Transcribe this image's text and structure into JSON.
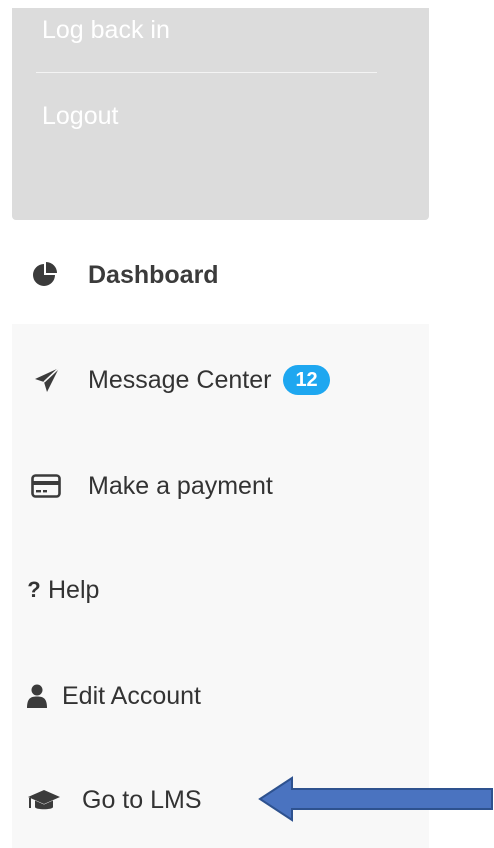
{
  "account_menu": {
    "login_label": "Log back in",
    "logout_label": "Logout"
  },
  "dashboard": {
    "label": "Dashboard",
    "icon": "pie-chart-icon"
  },
  "nav": {
    "items": [
      {
        "label": "Message Center",
        "icon": "paper-plane-icon",
        "badge": "12"
      },
      {
        "label": "Make a payment",
        "icon": "credit-card-icon"
      },
      {
        "label": "Help",
        "icon": "question-icon"
      },
      {
        "label": "Edit Account",
        "icon": "user-icon"
      },
      {
        "label": "Go to LMS",
        "icon": "graduation-cap-icon"
      }
    ]
  },
  "colors": {
    "badge": "#1ea7f0",
    "menu_background": "#dcdcdc",
    "nav_background": "#f8f8f8",
    "annotation_arrow": "#4a73c0"
  }
}
